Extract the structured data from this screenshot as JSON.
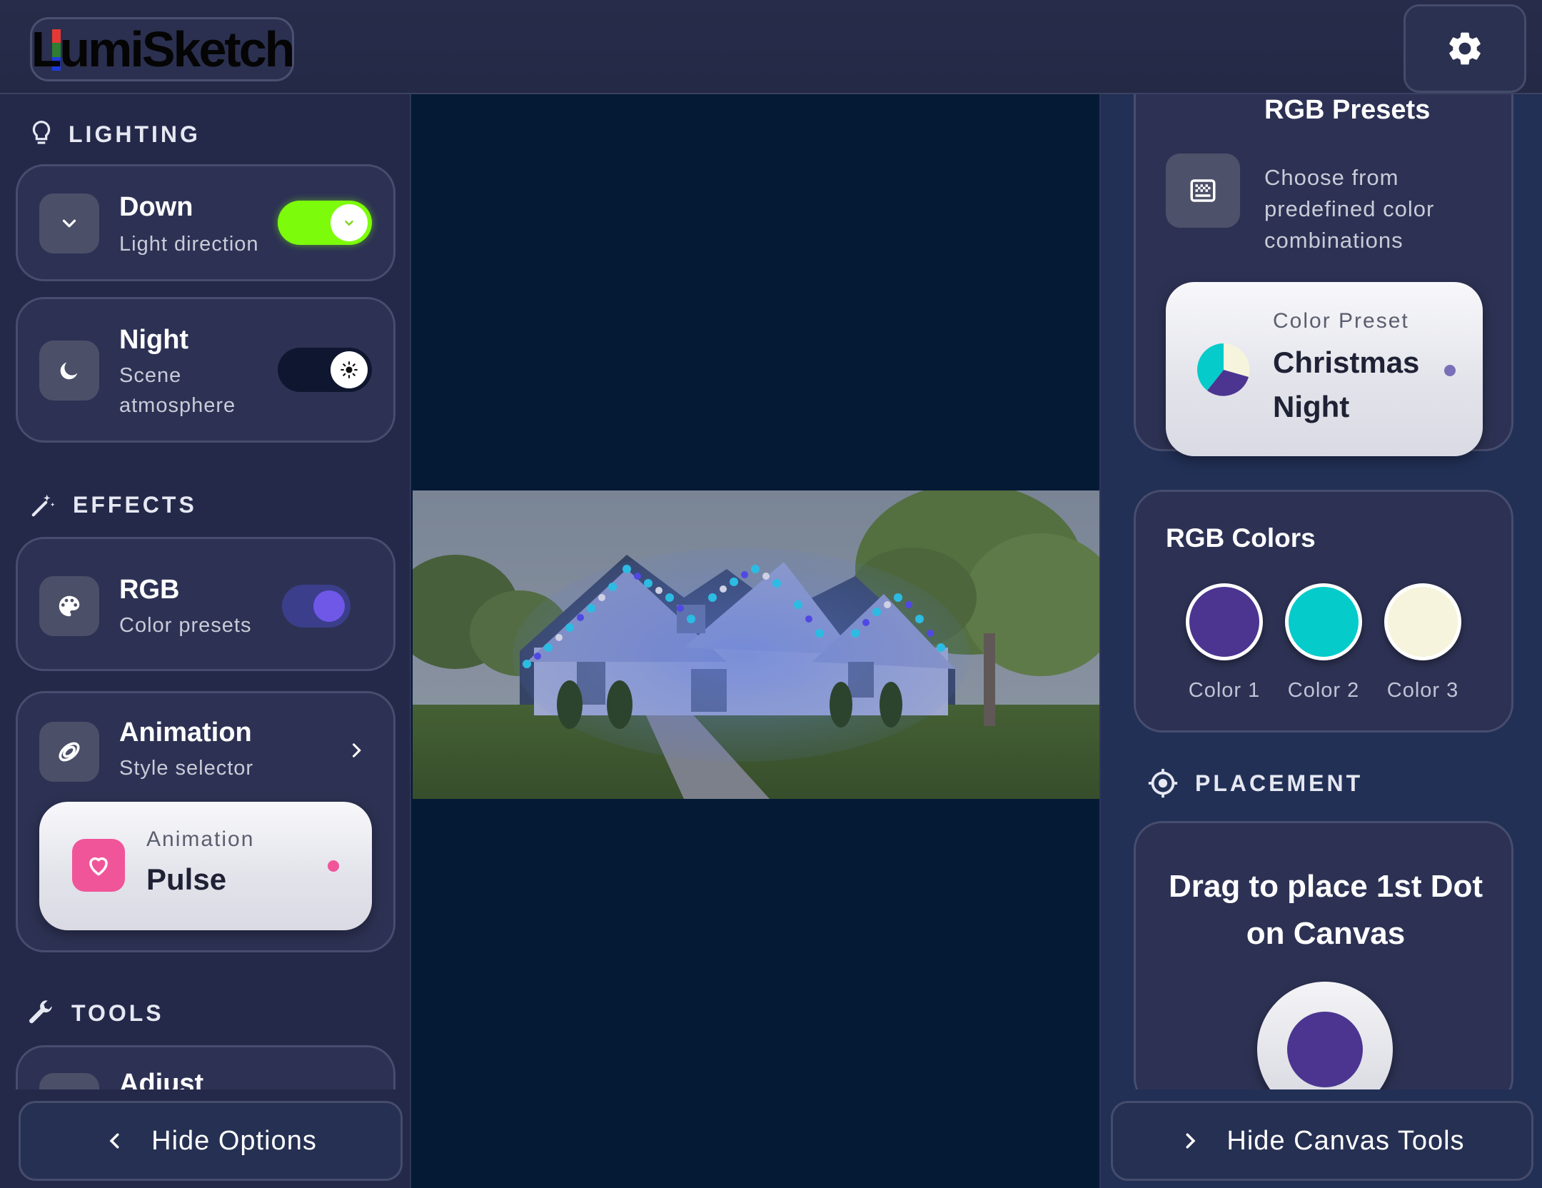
{
  "app": {
    "logo_text": "LumiSketch"
  },
  "left": {
    "lighting_heading": "LIGHTING",
    "direction": {
      "title": "Down",
      "subtitle": "Light direction",
      "toggle_on": true
    },
    "scene": {
      "title": "Night",
      "subtitle": "Scene atmosphere",
      "toggle_on": false
    },
    "effects_heading": "EFFECTS",
    "rgb": {
      "title": "RGB",
      "subtitle": "Color presets",
      "toggle_on": true
    },
    "animation": {
      "title": "Animation",
      "subtitle": "Style selector",
      "select_label": "Animation",
      "select_value": "Pulse"
    },
    "tools_heading": "TOOLS",
    "adjust": {
      "title": "Adjust"
    },
    "hide_button": "Hide Options"
  },
  "right": {
    "presets": {
      "title": "RGB Presets",
      "description": "Choose from predefined color combinations",
      "select_label": "Color Preset",
      "select_value": "Christmas Night"
    },
    "colors": {
      "title": "RGB Colors",
      "items": [
        {
          "label": "Color 1",
          "hex": "#4b3591"
        },
        {
          "label": "Color 2",
          "hex": "#06cbcb"
        },
        {
          "label": "Color 3",
          "hex": "#f6f4dc"
        }
      ]
    },
    "placement_heading": "PLACEMENT",
    "placement_text": "Drag to place 1st Dot on Canvas",
    "hide_button": "Hide Canvas Tools"
  },
  "theme": {
    "accent_green": "#7cfc0a",
    "accent_purple": "#6f57e8",
    "pink": "#f0559a"
  }
}
